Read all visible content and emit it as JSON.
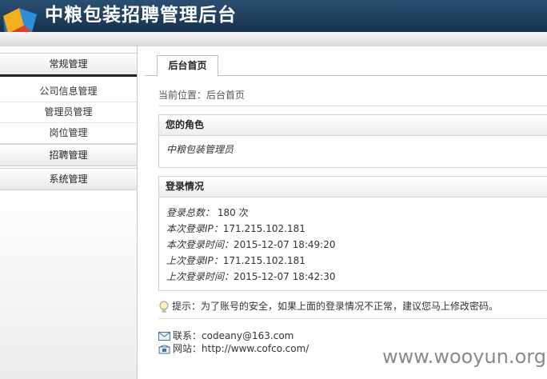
{
  "header": {
    "title": "中粮包装招聘管理后台"
  },
  "sidebar": {
    "groups": [
      {
        "label": "常规管理",
        "items": [
          "公司信息管理",
          "管理员管理",
          "岗位管理"
        ]
      },
      {
        "label": "招聘管理"
      },
      {
        "label": "系统管理"
      }
    ]
  },
  "main": {
    "tab": "后台首页",
    "breadcrumb": "当前位置：后台首页",
    "role": {
      "title": "您的角色",
      "value": "中粮包装管理员"
    },
    "login": {
      "title": "登录情况",
      "total_label": "登录总数：",
      "total_value": "180 次",
      "cur_ip_label": "本次登录IP：",
      "cur_ip": "171.215.102.181",
      "cur_time_label": "本次登录时间：",
      "cur_time": "2015-12-07 18:49:20",
      "last_ip_label": "上次登录IP：",
      "last_ip": "171.215.102.181",
      "last_time_label": "上次登录时间：",
      "last_time": "2015-12-07 18:42:30"
    },
    "tip": {
      "text": "提示：为了账号的安全，如果上面的登录情况不正常，建议您马上",
      "link": "修改密码",
      "end": "。"
    },
    "contact": {
      "email_label": "联系：",
      "email": "codeany@163.com",
      "site_label": "网站：",
      "site": "http://www.cofco.com/"
    }
  },
  "watermark": "www.wooyun.org"
}
